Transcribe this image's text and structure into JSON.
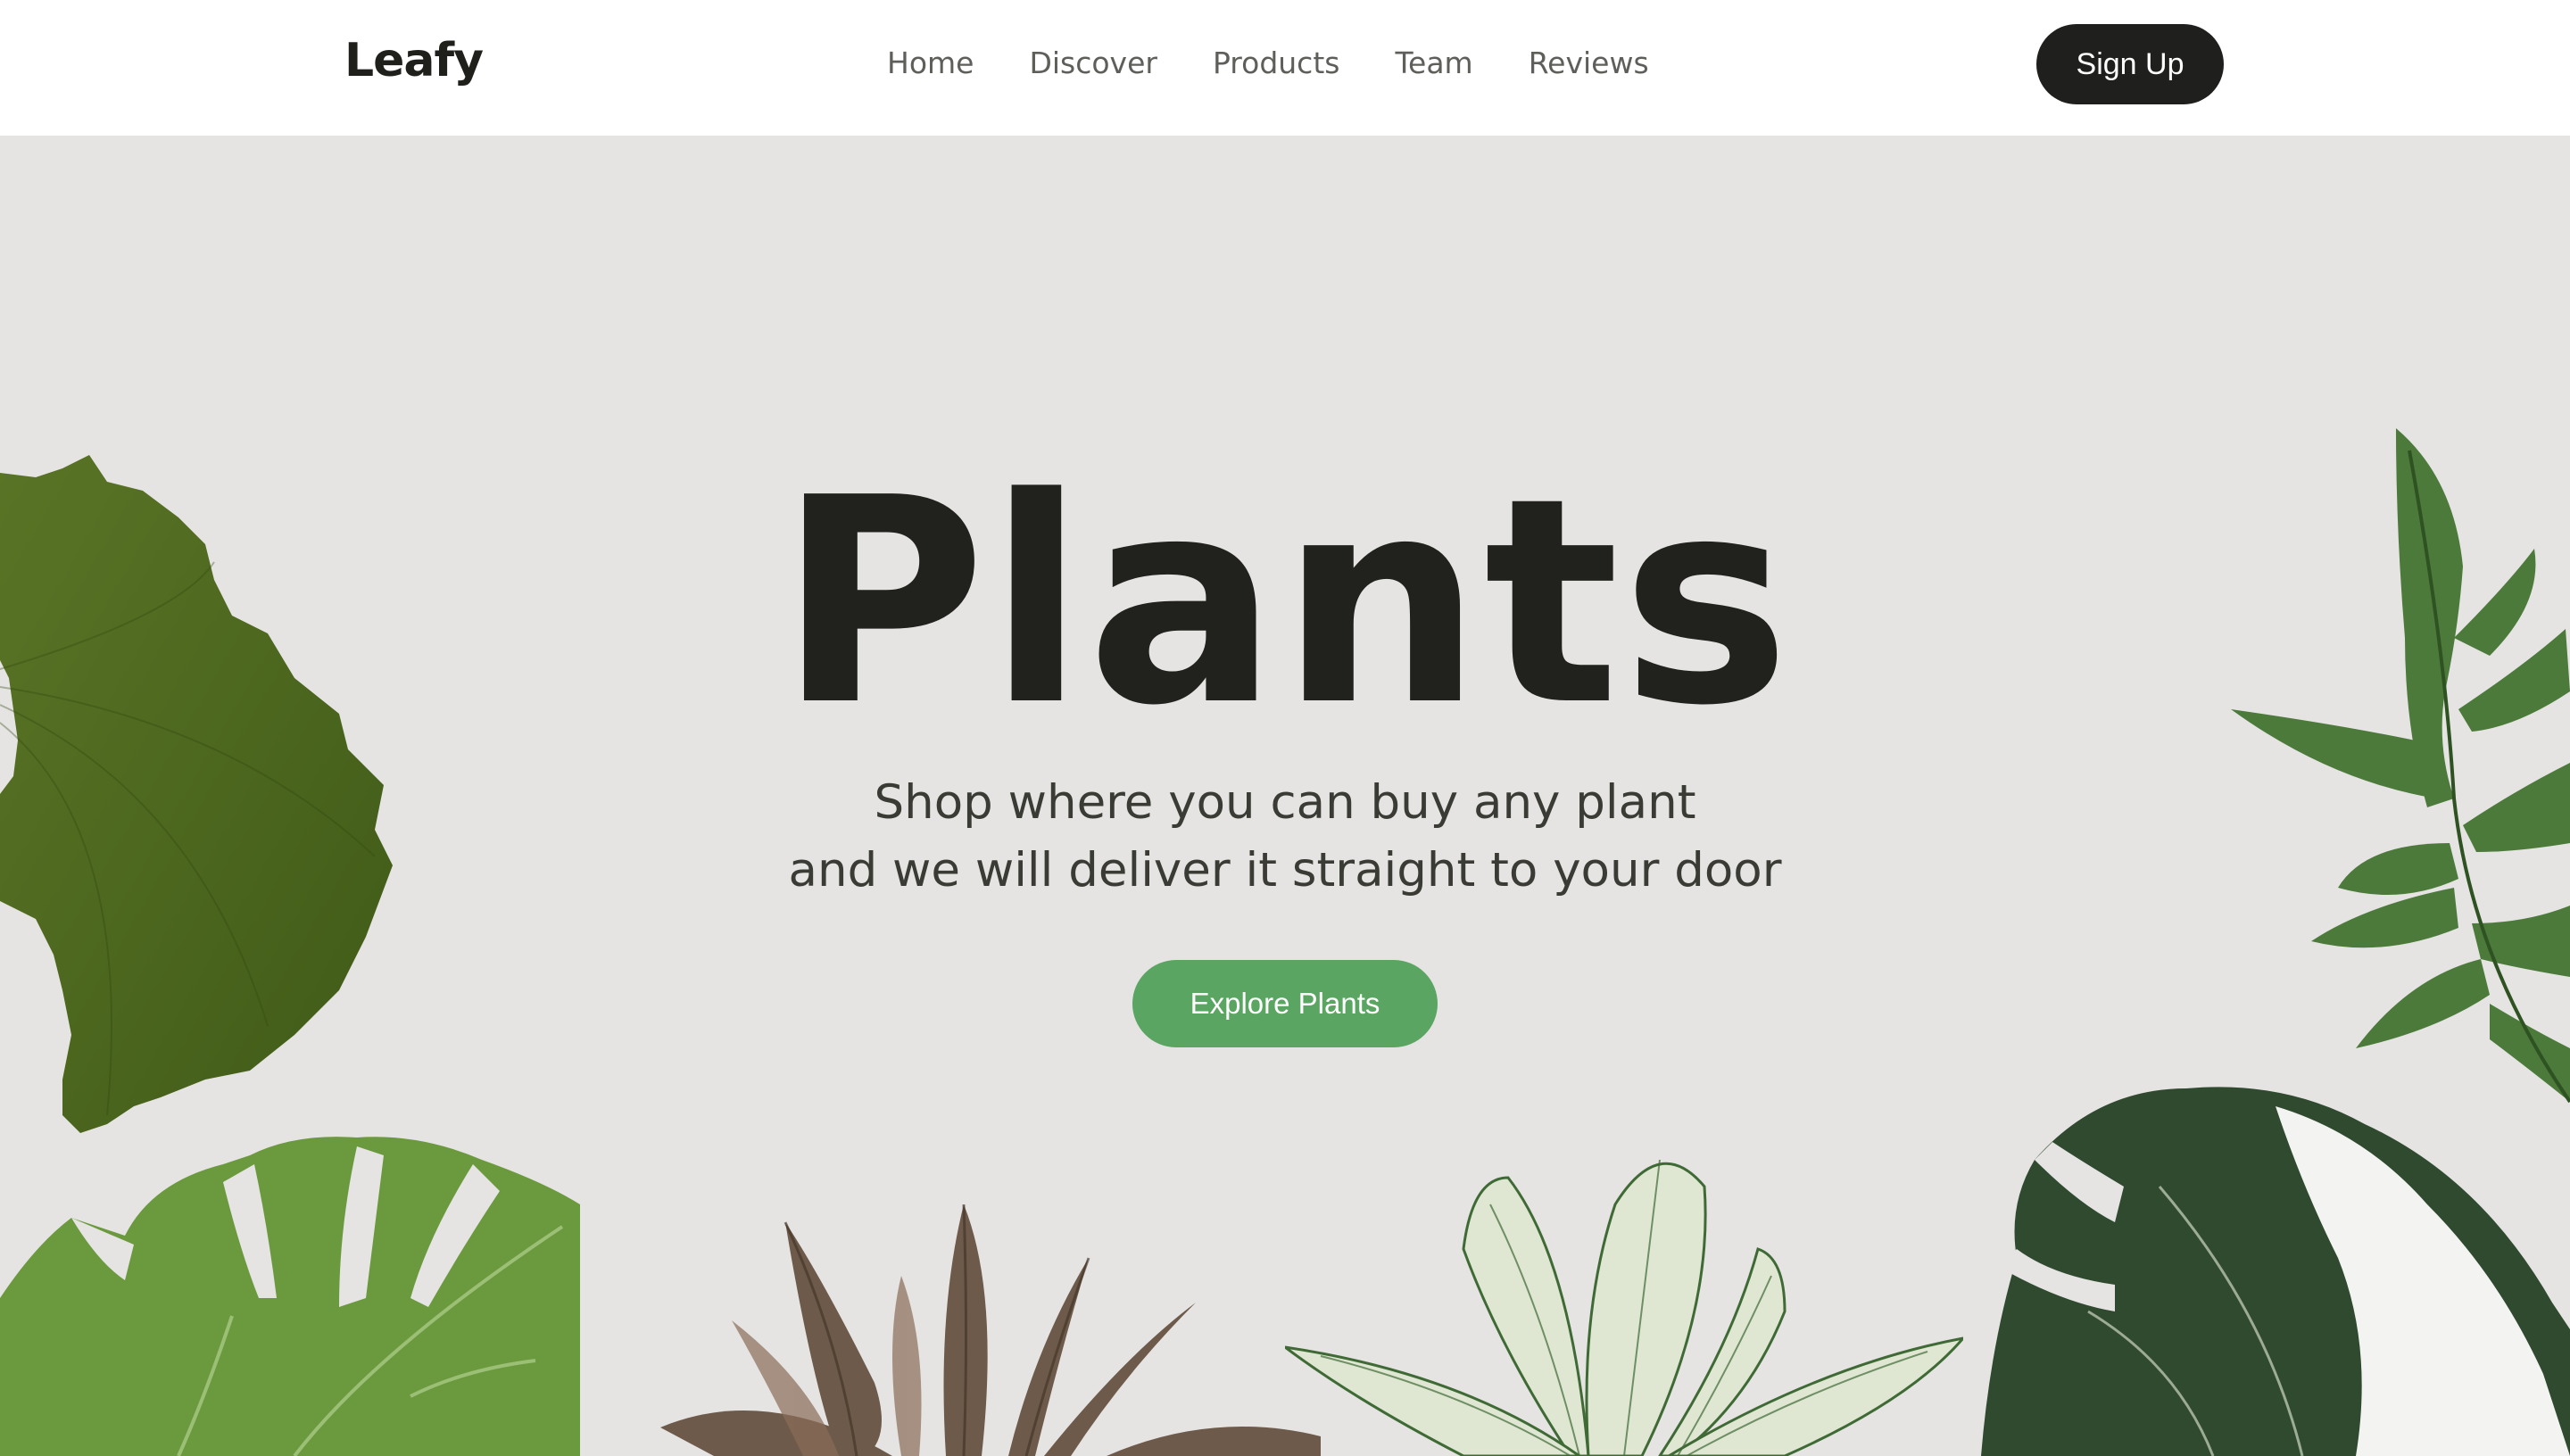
{
  "header": {
    "logo": "Leafy",
    "nav": [
      "Home",
      "Discover",
      "Products",
      "Team",
      "Reviews"
    ],
    "signup_label": "Sign Up"
  },
  "hero": {
    "title": "Plants",
    "subtitle_line1": "Shop where you can buy any plant",
    "subtitle_line2": "and we will deliver it straight to your door",
    "cta_label": "Explore Plants"
  },
  "colors": {
    "background": "#e5e4e3",
    "header_bg": "#ffffff",
    "dark": "#1f1f1d",
    "accent_green": "#5aa561"
  },
  "images": [
    "ginkgo-leaf",
    "fern-leaf",
    "monstera-leaf",
    "red-calathea-plant",
    "striped-calathea-plant",
    "variegated-monstera-leaf"
  ]
}
